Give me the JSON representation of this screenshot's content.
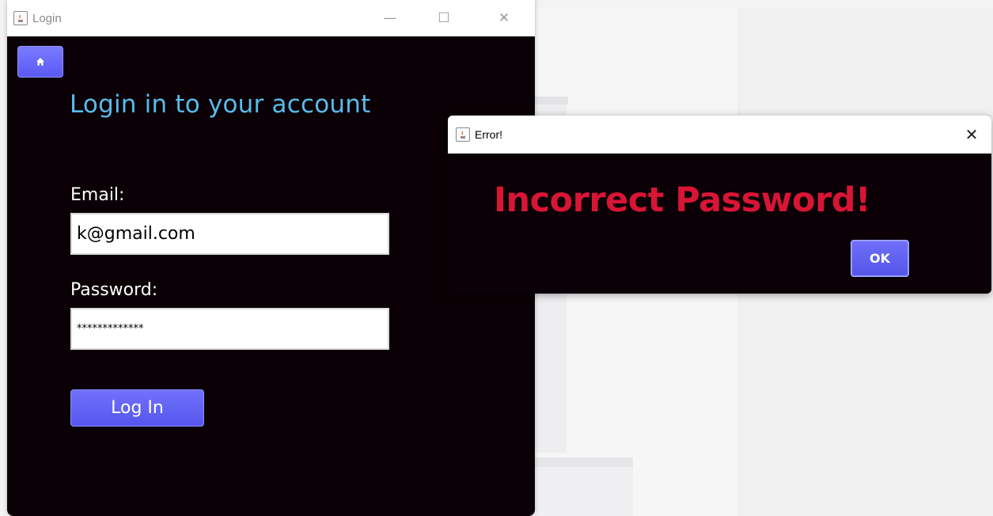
{
  "login_window": {
    "title": "Login",
    "heading": "Login in to your account",
    "email_label": "Email:",
    "email_value": "k@gmail.com",
    "password_label": "Password:",
    "password_value": "*************",
    "login_button_label": "Log In",
    "controls": {
      "minimize": "—",
      "maximize": "☐",
      "close": "✕"
    }
  },
  "error_dialog": {
    "title": "Error!",
    "message": "Incorrect Password!",
    "ok_label": "OK",
    "close": "✕"
  },
  "colors": {
    "window_bg": "#0a0005",
    "heading": "#58bbeb",
    "accent_button": "#5f5ff3",
    "error_text": "#d91536"
  },
  "icons": [
    "java-app-icon",
    "home-icon",
    "minimize-icon",
    "maximize-icon",
    "close-icon"
  ]
}
